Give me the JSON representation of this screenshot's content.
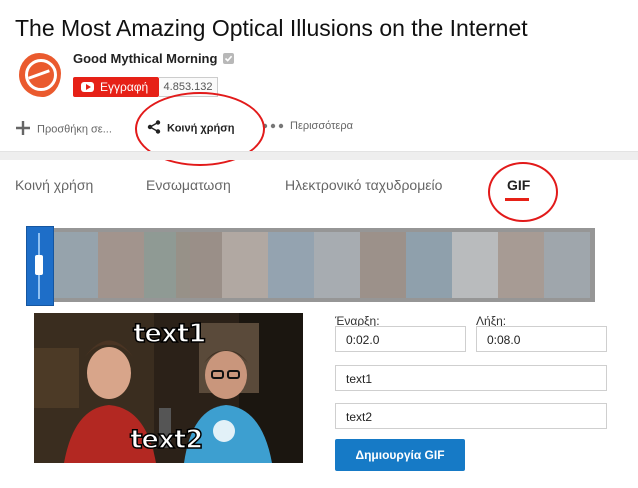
{
  "video": {
    "title": "The Most Amazing Optical Illusions on the Internet"
  },
  "channel": {
    "name": "Good Mythical Morning",
    "subscribe_label": "Εγγραφή",
    "subscriber_count": "4.853.132",
    "logo_icon": "good-mythical-morning-logo",
    "brand_color": "#e62117"
  },
  "actions": {
    "add_to": "Προσθήκη σε...",
    "share": "Κοινή χρήση",
    "more": "Περισσότερα"
  },
  "share_tabs": [
    {
      "label": "Κοινή χρήση",
      "active": false
    },
    {
      "label": "Ενσωματωση",
      "active": false
    },
    {
      "label": "Ηλεκτρονικό ταχυδρομείο",
      "active": false
    },
    {
      "label": "GIF",
      "active": true
    }
  ],
  "gif": {
    "captions": {
      "top": "text1",
      "bottom": "text2"
    },
    "start_label": "Έναρξη:",
    "start_value": "0:02.0",
    "end_label": "Λήξη:",
    "end_value": "0:08.0",
    "text1_value": "text1",
    "text2_value": "text2",
    "create_label": "Δημιουργία GIF",
    "accent_color": "#167ac6"
  },
  "annotation_color": "#e21a1a"
}
